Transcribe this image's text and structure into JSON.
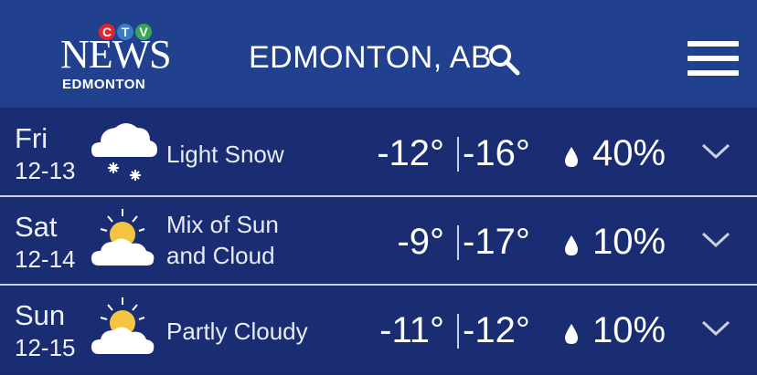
{
  "header": {
    "logo": {
      "ctv_letters": [
        "C",
        "T",
        "V"
      ],
      "news": "NEWS",
      "sub": "EDMONTON"
    },
    "city": "EDMONTON, AB",
    "search_icon": "search-icon",
    "menu_icon": "hamburger-menu-icon"
  },
  "colors": {
    "header_bg": "#21418f",
    "row_bg": "#1b2d72",
    "ctv_c": "#e2242b",
    "ctv_t": "#3b7dc4",
    "ctv_v": "#3aa655",
    "sun": "#f4c542"
  },
  "forecast": [
    {
      "day": "Fri",
      "date": "12-13",
      "condition_line1": "Light Snow",
      "condition_line2": "",
      "icon": "snow-cloud-icon",
      "high": "-12°",
      "low": "-16°",
      "pop": "40%"
    },
    {
      "day": "Sat",
      "date": "12-14",
      "condition_line1": "Mix of Sun",
      "condition_line2": "and Cloud",
      "icon": "sun-cloud-icon",
      "high": "-9°",
      "low": "-17°",
      "pop": "10%"
    },
    {
      "day": "Sun",
      "date": "12-15",
      "condition_line1": "Partly Cloudy",
      "condition_line2": "",
      "icon": "sun-cloud-icon",
      "high": "-11°",
      "low": "-12°",
      "pop": "10%"
    }
  ]
}
